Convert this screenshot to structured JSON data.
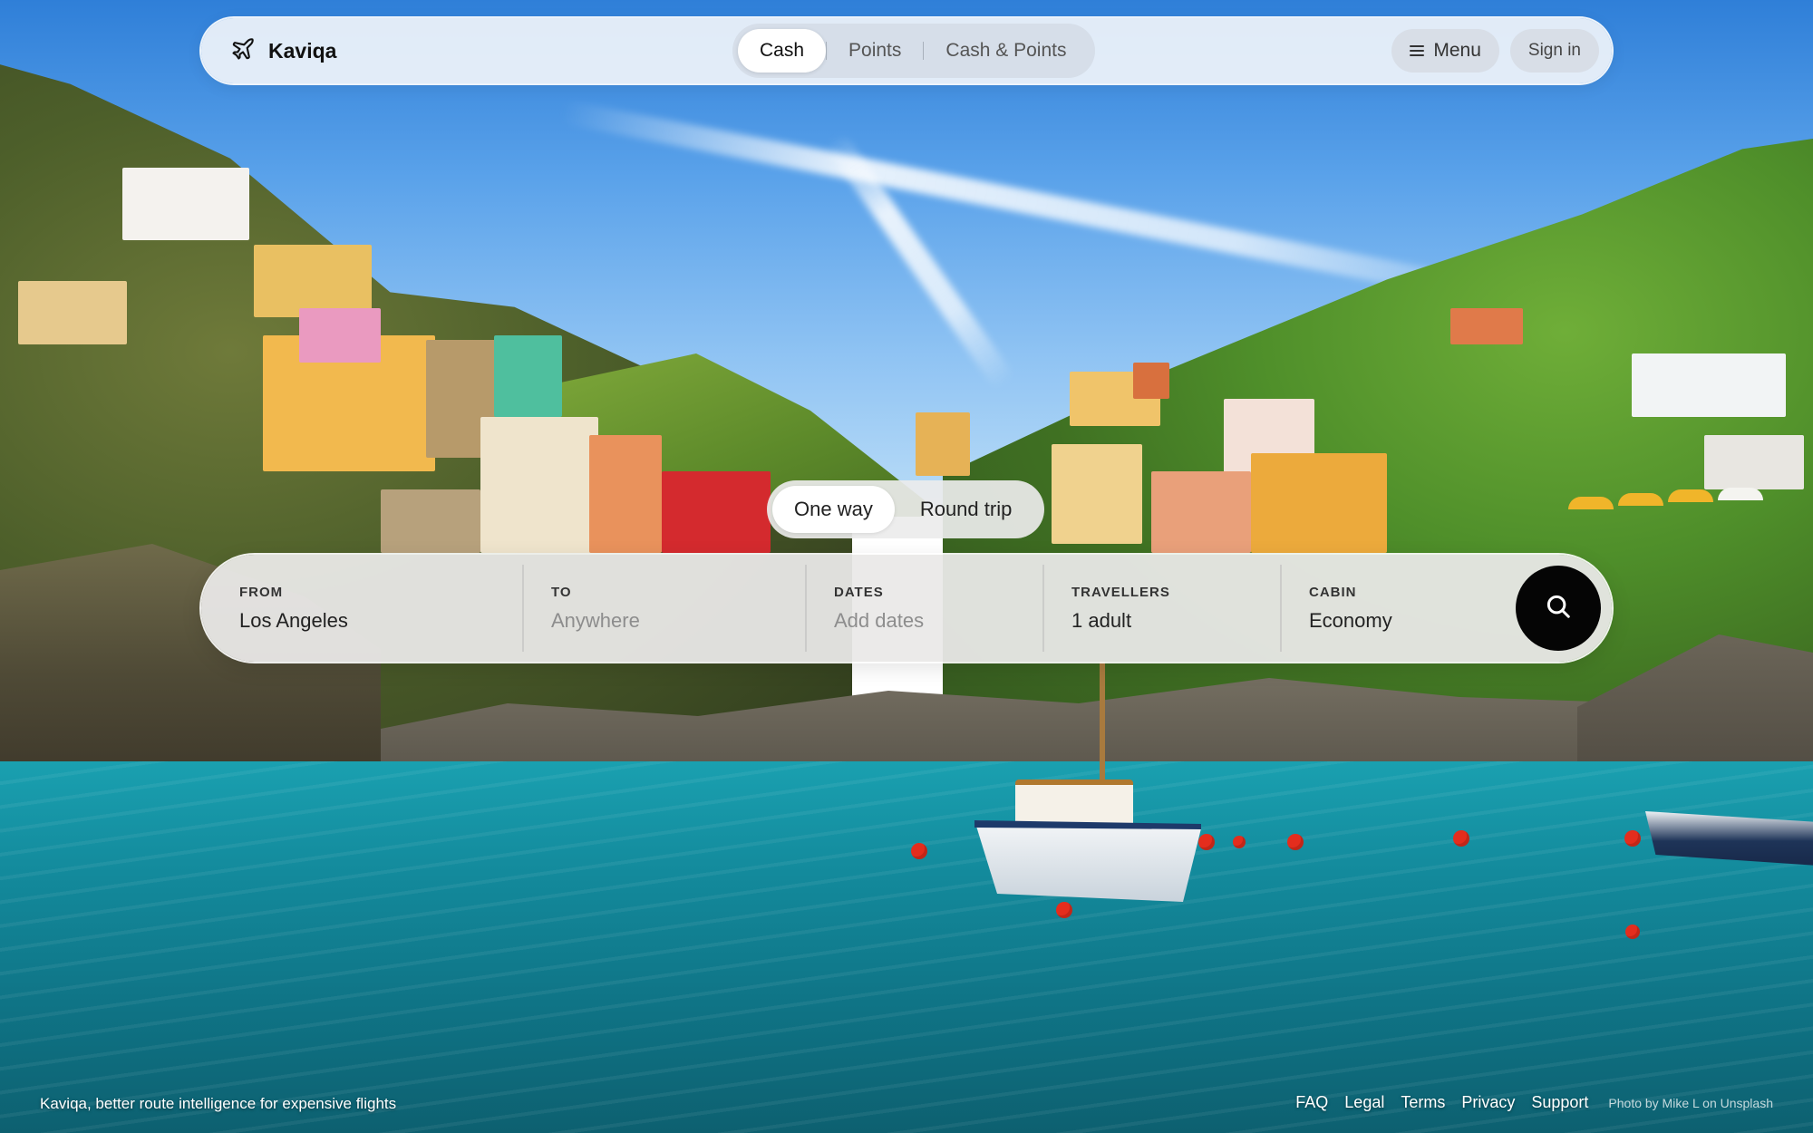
{
  "brand": {
    "name": "Kaviqa",
    "logo_icon": "airplane-icon"
  },
  "payment_modes": {
    "options": [
      "Cash",
      "Points",
      "Cash & Points"
    ],
    "selected": "Cash"
  },
  "nav": {
    "menu_label": "Menu",
    "signin_label": "Sign in"
  },
  "trip_type": {
    "options": [
      "One way",
      "Round trip"
    ],
    "selected": "One way"
  },
  "search": {
    "from": {
      "label": "FROM",
      "value": "Los Angeles"
    },
    "to": {
      "label": "TO",
      "placeholder": "Anywhere"
    },
    "dates": {
      "label": "DATES",
      "placeholder": "Add dates"
    },
    "travellers": {
      "label": "TRAVELLERS",
      "value": "1 adult"
    },
    "cabin": {
      "label": "CABIN",
      "value": "Economy"
    },
    "button_icon": "search-icon"
  },
  "footer": {
    "tagline": "Kaviqa, better route intelligence for expensive flights",
    "links": [
      "FAQ",
      "Legal",
      "Terms",
      "Privacy",
      "Support"
    ],
    "photo_credit": "Photo by Mike L on Unsplash"
  },
  "colors": {
    "search_button": "#050505",
    "active_pill": "#ffffff",
    "bar_background": "#eae9e8"
  }
}
